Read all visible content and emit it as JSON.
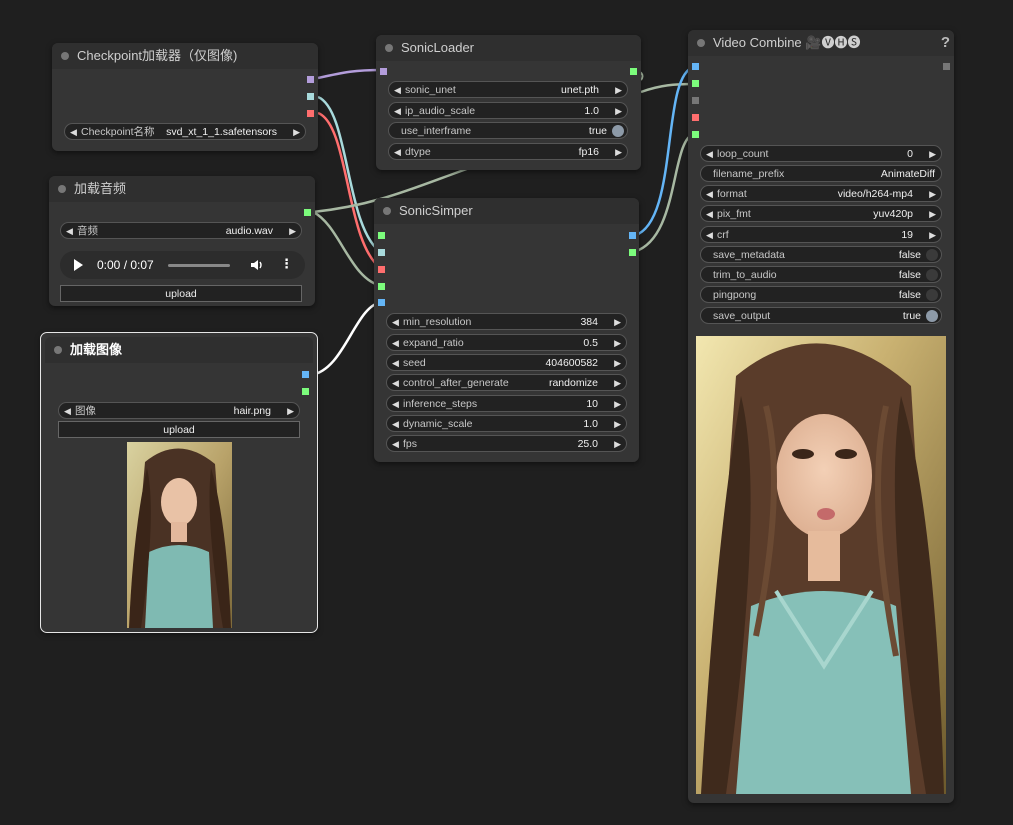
{
  "nodes": {
    "checkpoint": {
      "title": "Checkpoint加载器（仅图像)",
      "ckpt_label": "Checkpoint名称",
      "ckpt_value": "svd_xt_1_1.safetensors"
    },
    "audio_loader": {
      "title": "加载音频",
      "audio_label": "音频",
      "audio_value": "audio.wav",
      "player_time": "0:00 / 0:07",
      "upload_label": "upload"
    },
    "image_loader": {
      "title": "加载图像",
      "image_label": "图像",
      "image_value": "hair.png",
      "upload_label": "upload"
    },
    "sonic_loader": {
      "title": "SonicLoader",
      "widgets": [
        {
          "label": "sonic_unet",
          "value": "unet.pth"
        },
        {
          "label": "ip_audio_scale",
          "value": "1.0"
        },
        {
          "label": "use_interframe",
          "value": "true"
        },
        {
          "label": "dtype",
          "value": "fp16"
        }
      ]
    },
    "sonic_simper": {
      "title": "SonicSimper",
      "widgets": [
        {
          "label": "min_resolution",
          "value": "384"
        },
        {
          "label": "expand_ratio",
          "value": "0.5"
        },
        {
          "label": "seed",
          "value": "404600582"
        },
        {
          "label": "control_after_generate",
          "value": "randomize"
        },
        {
          "label": "inference_steps",
          "value": "10"
        },
        {
          "label": "dynamic_scale",
          "value": "1.0"
        },
        {
          "label": "fps",
          "value": "25.0"
        }
      ]
    },
    "video_combine": {
      "title": "Video Combine 🎥🅥🅗🅢",
      "help": "?",
      "widgets": [
        {
          "label": "loop_count",
          "value": "0"
        },
        {
          "label": "filename_prefix",
          "value": "AnimateDiff"
        },
        {
          "label": "format",
          "value": "video/h264-mp4"
        },
        {
          "label": "pix_fmt",
          "value": "yuv420p"
        },
        {
          "label": "crf",
          "value": "19"
        },
        {
          "label": "save_metadata",
          "value": "false"
        },
        {
          "label": "trim_to_audio",
          "value": "false"
        },
        {
          "label": "pingpong",
          "value": "false"
        },
        {
          "label": "save_output",
          "value": "true"
        }
      ]
    }
  },
  "colors": {
    "model_port": "#b39ddb",
    "clip_port": "#a8dadc",
    "vae_port": "#ff6e6e",
    "audio_port": "#7cfc7c",
    "image_port": "#64b5f6",
    "wire_model": "#b39ddb",
    "wire_clip": "#a8dadc",
    "wire_vae": "#ff6e6e",
    "wire_audio": "#a7b8a2",
    "wire_image": "#64b5f6"
  },
  "icons": [
    "play-icon",
    "volume-icon",
    "more-options-icon",
    "help-icon",
    "arrow-left-icon",
    "arrow-right-icon"
  ]
}
